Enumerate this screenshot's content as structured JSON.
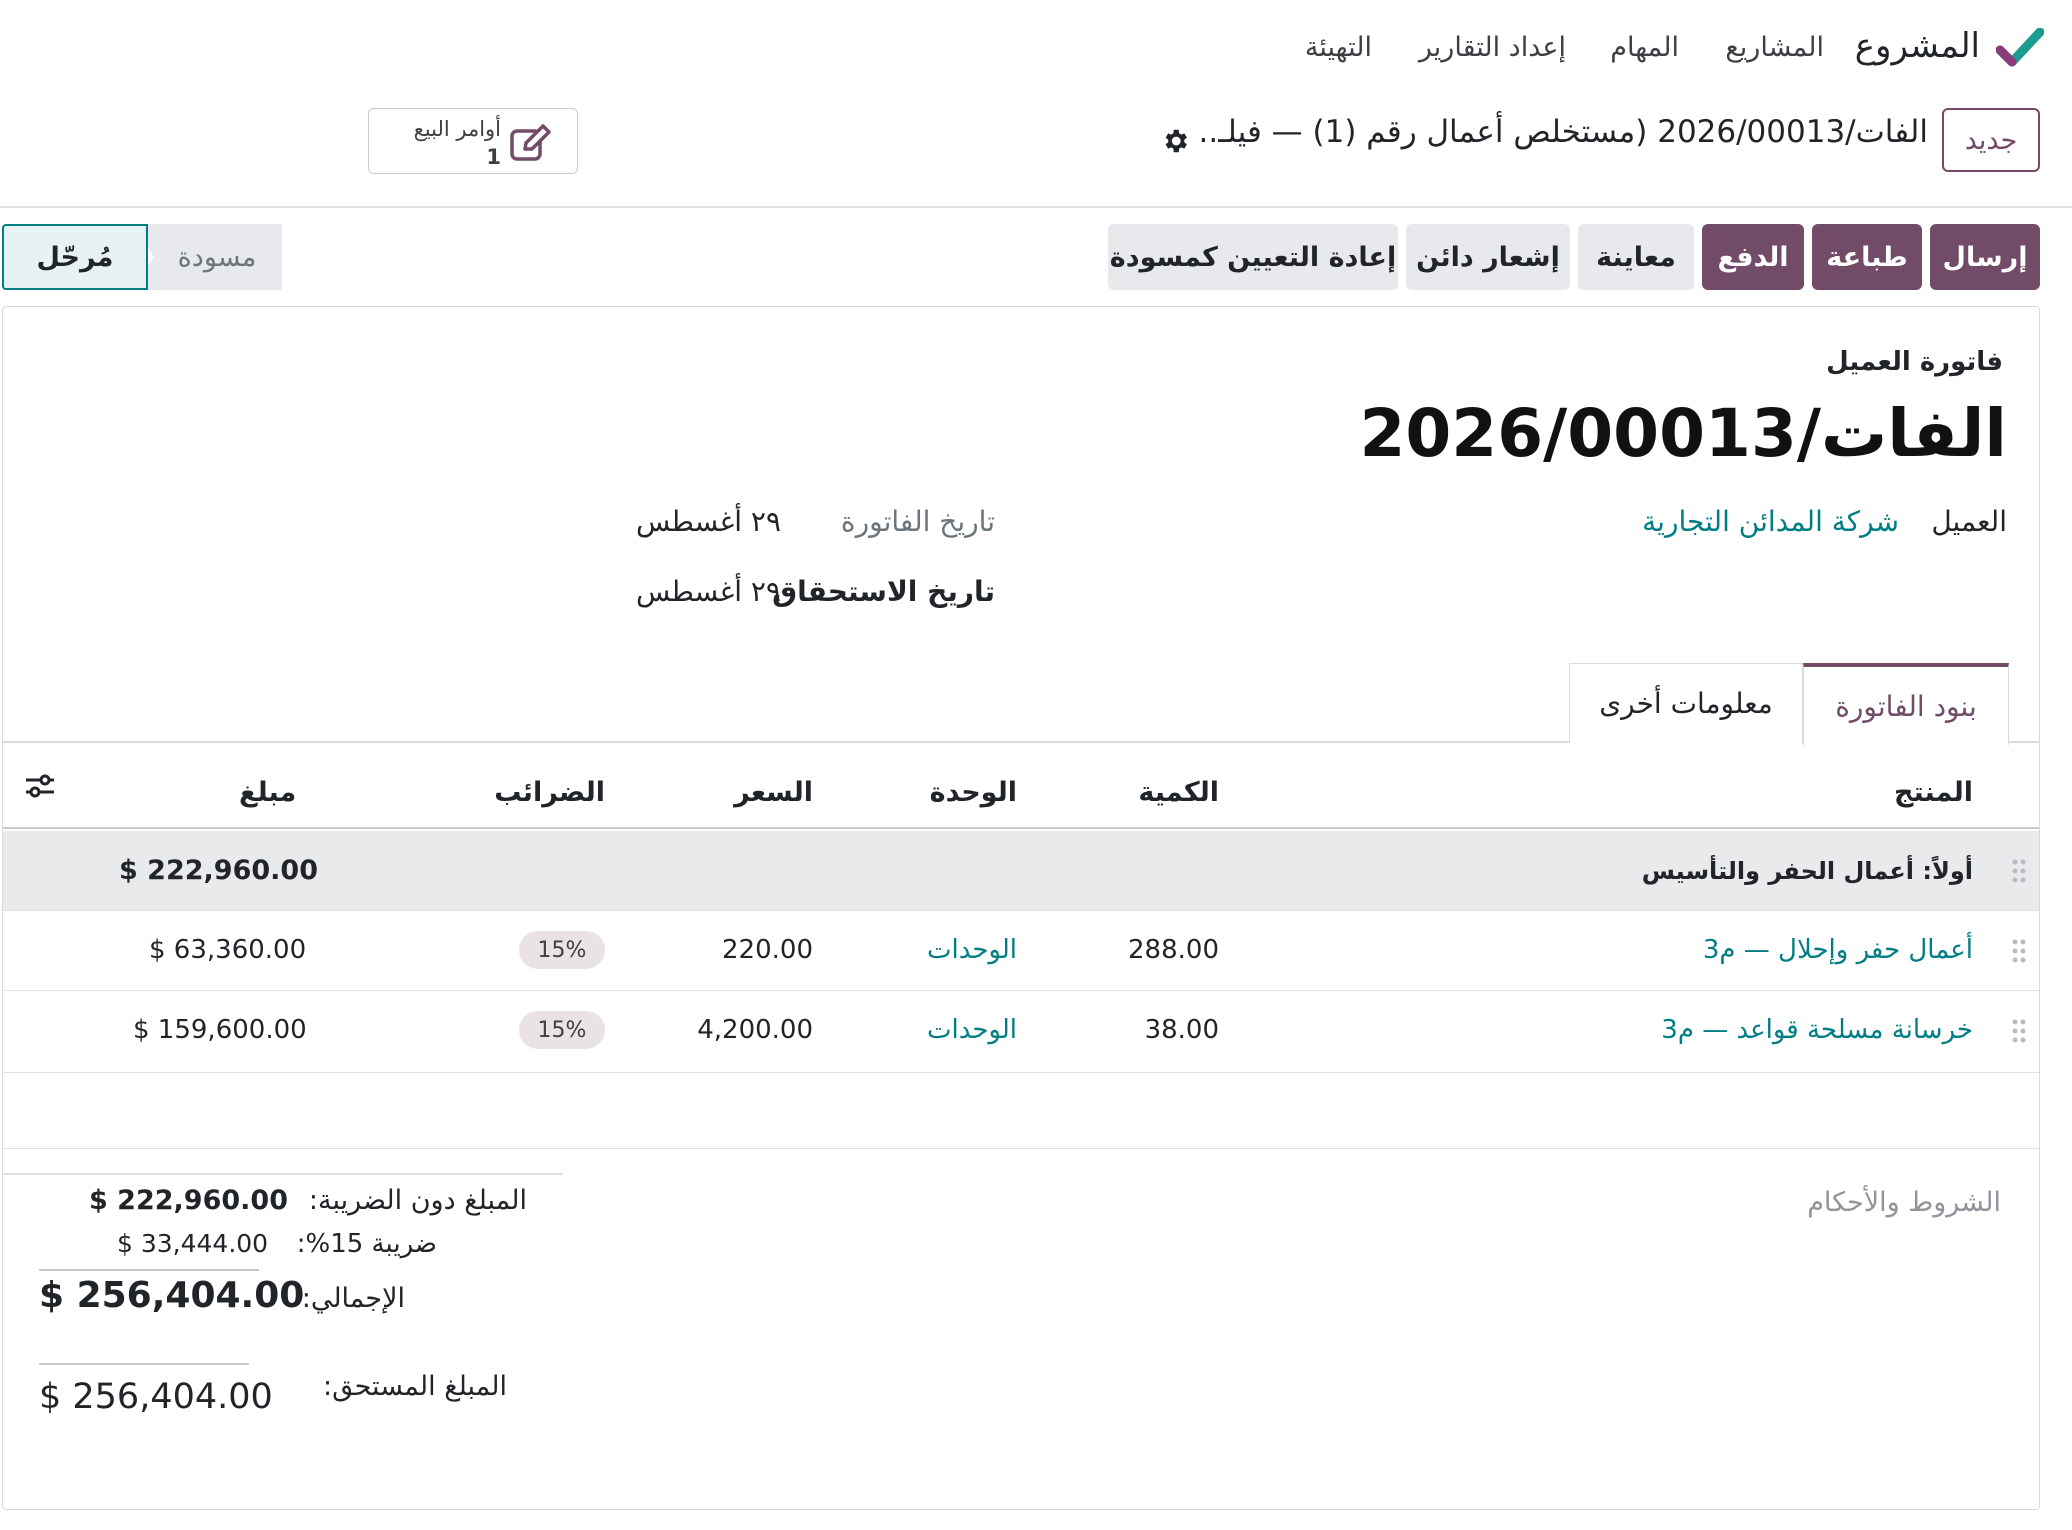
{
  "nav": {
    "app_name": "المشروع",
    "items": [
      "المشاريع",
      "المهام",
      "إعداد التقارير",
      "التهيئة"
    ]
  },
  "breadcrumb": {
    "new_label": "جديد",
    "title": "الفات/2026/00013 (مستخلص أعمال رقم (1) — فيلـ.."
  },
  "smart_button": {
    "label": "أوامر البيع",
    "count": "1"
  },
  "actions": {
    "send": "إرسال",
    "print": "طباعة",
    "pay": "الدفع",
    "preview": "معاينة",
    "credit_note": "إشعار دائن",
    "reset_draft": "إعادة التعيين كمسودة"
  },
  "status": {
    "posted": "مُرحّل",
    "draft": "مسودة"
  },
  "invoice": {
    "type": "فاتورة العميل",
    "number": "الفات/2026/00013",
    "customer_label": "العميل",
    "customer": "شركة المدائن التجارية",
    "invoice_date_label": "تاريخ الفاتورة",
    "invoice_date": "٢٩ أغسطس",
    "due_date_label": "تاريخ الاستحقاق",
    "due_date": "٢٩ أغسطس"
  },
  "tabs": {
    "lines": "بنود الفاتورة",
    "other": "معلومات أخرى"
  },
  "table": {
    "headers": {
      "product": "المنتج",
      "quantity": "الكمية",
      "uom": "الوحدة",
      "price": "السعر",
      "taxes": "الضرائب",
      "amount": "مبلغ"
    },
    "section": {
      "title": "أولاً: أعمال الحفر والتأسيس",
      "amount": "$ 222,960.00"
    },
    "rows": [
      {
        "product": "أعمال حفر وإحلال — م3",
        "quantity": "288.00",
        "uom": "الوحدات",
        "price": "220.00",
        "tax": "15%",
        "amount": "$ 63,360.00"
      },
      {
        "product": "خرسانة مسلحة قواعد — م3",
        "quantity": "38.00",
        "uom": "الوحدات",
        "price": "4,200.00",
        "tax": "15%",
        "amount": "$ 159,600.00"
      }
    ]
  },
  "footer": {
    "terms": "الشروط والأحكام",
    "untaxed_label": "المبلغ دون الضريبة:",
    "untaxed": "$ 222,960.00",
    "tax_label": "ضريبة 15%:",
    "tax": "$ 33,444.00",
    "total_label": "الإجمالي:",
    "total": "$ 256,404.00",
    "residual_label": "المبلغ المستحق:",
    "residual": "$ 256,404.00"
  },
  "colors": {
    "primary": "#714b67",
    "link": "#017e84",
    "secondary_bg": "#e7e9ed"
  }
}
